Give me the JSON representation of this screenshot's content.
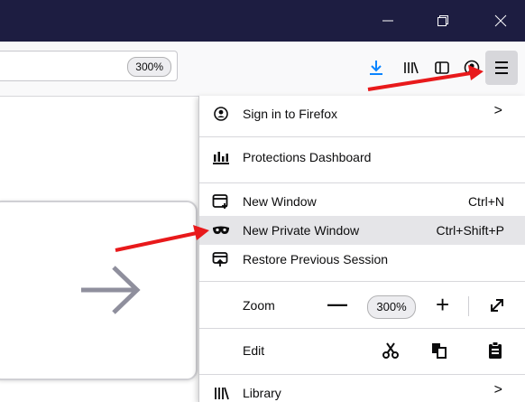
{
  "titlebar": {
    "background": "#1d1d41",
    "minimize_icon": "minimize-icon",
    "restore_icon": "restore-icon",
    "close_icon": "close-icon"
  },
  "toolbar": {
    "zoom_badge": "300%",
    "download_color": "#0a84ff",
    "icons": [
      "download-icon",
      "library-icon",
      "sidebar-icon",
      "account-icon",
      "hamburger-menu-icon"
    ]
  },
  "menu": {
    "sign_in": {
      "label": "Sign in to Firefox",
      "arrow": ">"
    },
    "protections": {
      "label": "Protections Dashboard"
    },
    "new_window": {
      "label": "New Window",
      "shortcut": "Ctrl+N"
    },
    "new_private_window": {
      "label": "New Private Window",
      "shortcut": "Ctrl+Shift+P"
    },
    "restore_session": {
      "label": "Restore Previous Session"
    },
    "zoom": {
      "label": "Zoom",
      "minus": "—",
      "value": "300%",
      "plus": "+"
    },
    "edit": {
      "label": "Edit"
    },
    "library": {
      "label": "Library",
      "arrow": ">"
    }
  },
  "annotation_color": "#e8191b"
}
